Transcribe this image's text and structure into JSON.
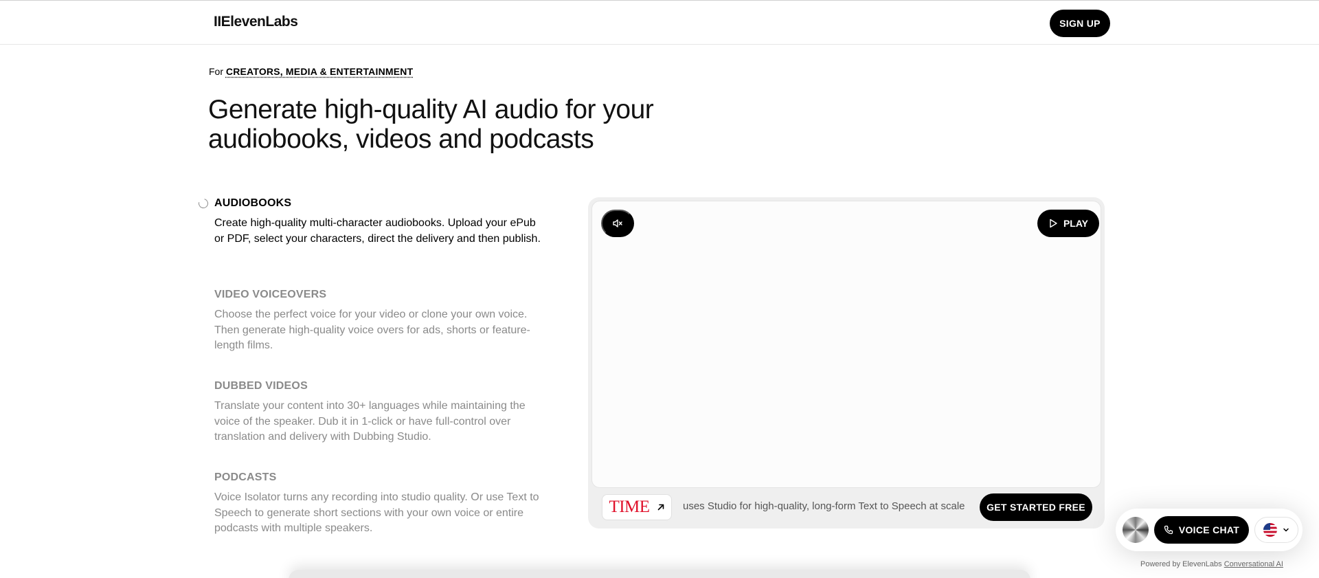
{
  "header": {
    "logo": "IIElevenLabs",
    "signup_label": "SIGN UP"
  },
  "hero": {
    "for_prefix": "For",
    "for_link": "CREATORS, MEDIA & ENTERTAINMENT",
    "headline_line1": "Generate high-quality AI audio for your",
    "headline_line2": "audiobooks, videos and podcasts"
  },
  "features": [
    {
      "title": "AUDIOBOOKS",
      "description": "Create high-quality multi-character audiobooks. Upload your ePub or PDF, select your characters, direct the delivery and then publish.",
      "active": true
    },
    {
      "title": "VIDEO VOICEOVERS",
      "description": "Choose the perfect voice for your video or clone your own voice. Then generate high-quality voice overs for ads, shorts or feature-length films.",
      "active": false
    },
    {
      "title": "DUBBED VIDEOS",
      "description": "Translate your content into 30+ languages while maintaining the voice of the speaker. Dub it in 1-click or have full-control over translation and delivery with Dubbing Studio.",
      "active": false
    },
    {
      "title": "PODCASTS",
      "description": "Voice Isolator turns any recording into studio quality. Or use Text to Speech to generate short sections with your own voice or entire podcasts with multiple speakers.",
      "active": false
    }
  ],
  "player": {
    "mute_icon": "speaker-muted-icon",
    "play_label": "PLAY",
    "customer_logo": "TIME",
    "caption": "uses Studio for high-quality, long-form Text to Speech at scale",
    "cta_label": "GET STARTED FREE"
  },
  "widget": {
    "voice_chat_label": "VOICE CHAT",
    "language_flag": "us-flag-icon",
    "powered_prefix": "Powered by ElevenLabs",
    "powered_link": "Conversational AI"
  },
  "colors": {
    "accent": "#000000",
    "time_red": "#e0102a",
    "muted_text": "#8a8a8a"
  }
}
